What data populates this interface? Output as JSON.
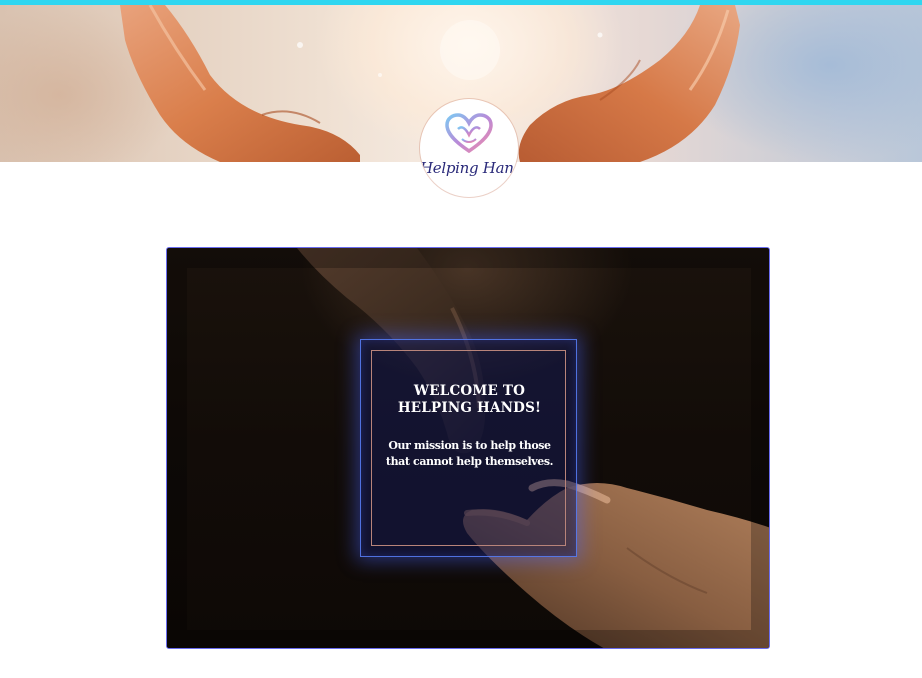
{
  "brand": {
    "logo_text": "Helping Hand",
    "accent_color": "#2fd6f0"
  },
  "hero": {
    "image": "open-hands-releasing-light"
  },
  "feature": {
    "image": "two-hands-reaching",
    "title_line1": "WELCOME TO",
    "title_line2": "HELPING HANDS!",
    "body_line1": "Our mission is to help those",
    "body_line2": "that cannot help themselves.",
    "border_color": "#6a6cf0",
    "frame_color": "#b8847a"
  }
}
